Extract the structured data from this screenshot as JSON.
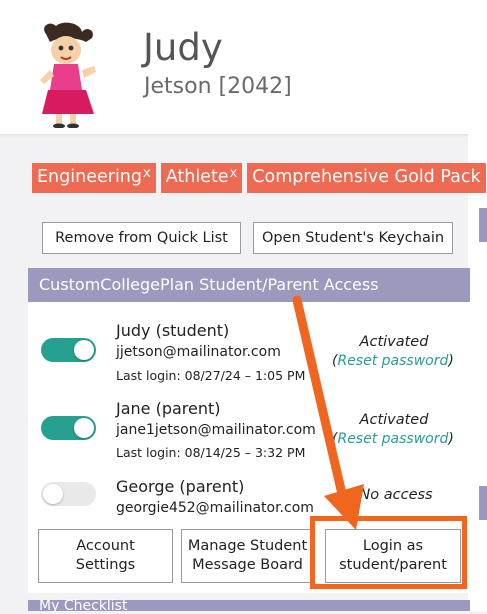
{
  "header": {
    "first_name": "Judy",
    "last_name_id": "Jetson [2042]"
  },
  "tags": [
    {
      "label": "Engineering",
      "remove": "x"
    },
    {
      "label": "Athlete",
      "remove": "x"
    },
    {
      "label": "Comprehensive Gold Pack",
      "remove": ""
    }
  ],
  "actions": {
    "remove_quick_list": "Remove from Quick List",
    "open_keychain": "Open Student's Keychain"
  },
  "access_section": {
    "title": "CustomCollegePlan Student/Parent Access",
    "users": [
      {
        "name": "Judy (student)",
        "email": "jjetson@mailinator.com",
        "last_login": "Last login: 08/27/24 – 1:05 PM",
        "enabled": true,
        "status": "Activated",
        "reset_label": "Reset password"
      },
      {
        "name": "Jane (parent)",
        "email": "jane1jetson@mailinator.com",
        "last_login": "Last login: 08/14/25 – 3:32 PM",
        "enabled": true,
        "status": "Activated",
        "reset_label": "Reset password"
      },
      {
        "name": "George (parent)",
        "email": "georgie452@mailinator.com",
        "last_login": "",
        "enabled": false,
        "status": "No access",
        "reset_label": ""
      }
    ],
    "buttons": {
      "account_settings_1": "Account",
      "account_settings_2": "Settings",
      "message_board_1": "Manage Student",
      "message_board_2": "Message Board",
      "login_as_1": "Login as",
      "login_as_2": "student/parent"
    }
  },
  "checklist_section": {
    "title": "My Checklist"
  },
  "colors": {
    "tag": "#ee6a52",
    "section_header": "#9c99bf",
    "toggle_on": "#26a18f",
    "link": "#2a9d8f",
    "highlight": "#f0661e"
  }
}
